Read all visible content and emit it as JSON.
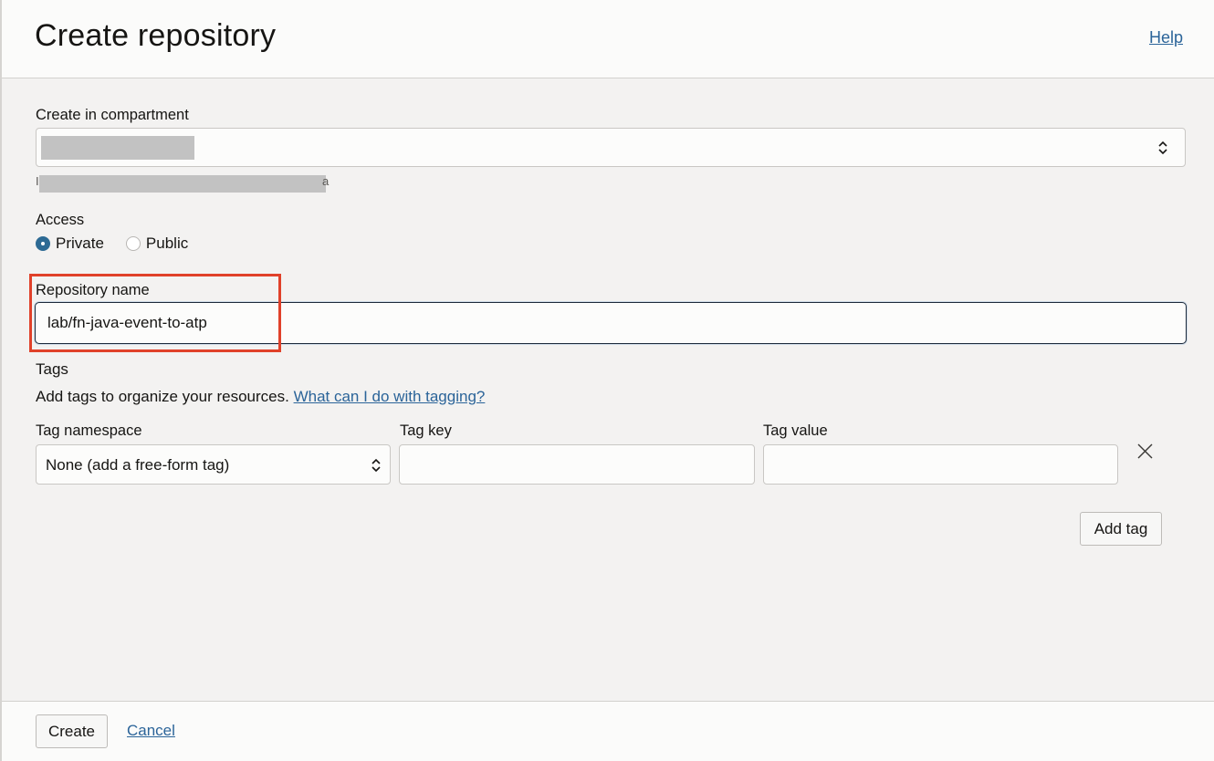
{
  "header": {
    "title": "Create repository",
    "help_label": "Help"
  },
  "compartment": {
    "label": "Create in compartment",
    "path_prefix": "I",
    "path_suffix": "a"
  },
  "access": {
    "label": "Access",
    "options": [
      {
        "label": "Private",
        "selected": true
      },
      {
        "label": "Public",
        "selected": false
      }
    ]
  },
  "repository_name": {
    "label": "Repository name",
    "value": "lab/fn-java-event-to-atp"
  },
  "tags": {
    "heading": "Tags",
    "description": "Add tags to organize your resources.",
    "help_link": "What can I do with tagging?",
    "namespace_label": "Tag namespace",
    "namespace_value": "None (add a free-form tag)",
    "key_label": "Tag key",
    "key_value": "",
    "value_label": "Tag value",
    "value_value": "",
    "remove_icon": "close-icon",
    "add_tag_label": "Add tag"
  },
  "footer": {
    "create_label": "Create",
    "cancel_label": "Cancel"
  },
  "colors": {
    "link": "#2b6499",
    "highlight": "#e0412a",
    "radio_selected": "#2d6a94"
  }
}
